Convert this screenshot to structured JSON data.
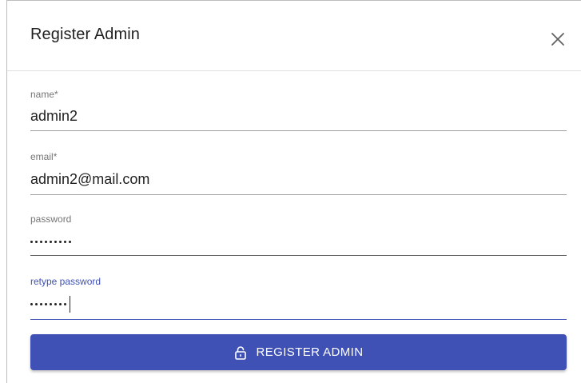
{
  "dialog": {
    "title": "Register Admin",
    "close_icon": "close-icon"
  },
  "form": {
    "name": {
      "label": "name",
      "required_mark": "*",
      "value": "admin2"
    },
    "email": {
      "label": "email",
      "required_mark": "*",
      "value": "admin2@mail.com"
    },
    "password": {
      "label": "password",
      "masked_length": 9
    },
    "retype_password": {
      "label": "retype password",
      "masked_length": 8,
      "focused": true
    }
  },
  "submit": {
    "label": "REGISTER ADMIN",
    "icon": "lock-icon"
  },
  "colors": {
    "accent": "#3f51b5",
    "text": "#212121",
    "muted": "#757575"
  }
}
